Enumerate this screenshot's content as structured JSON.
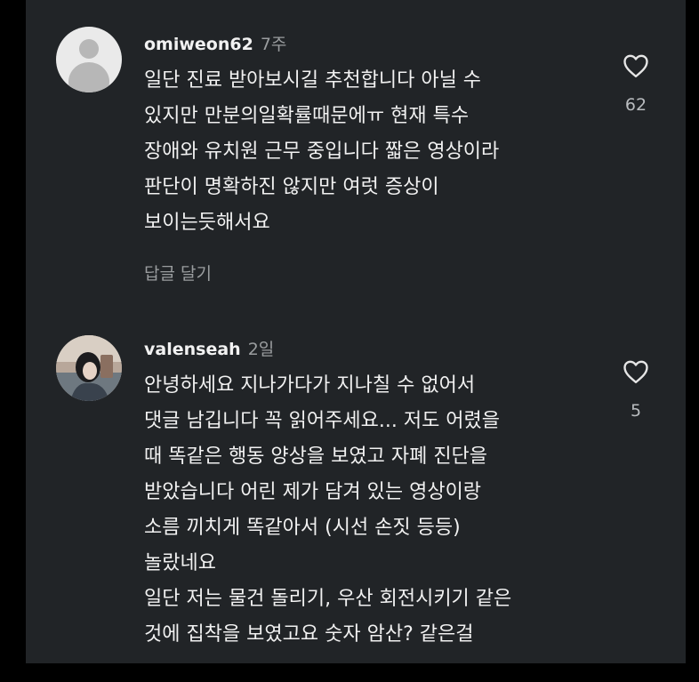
{
  "colors": {
    "panel_bg": "#212427",
    "outer_bg": "#000000",
    "text_primary": "#f1f1f1",
    "text_secondary": "#9a9d9f"
  },
  "comments": [
    {
      "username": "omiweon62",
      "time": "7주",
      "avatar": "default-avatar-icon",
      "lines": [
        "일단 진료 받아보시길 추천합니다 아닐 수",
        "있지만 만분의일확률때문에ㅠ 현재 특수",
        "장애와 유치원 근무 중입니다  짧은 영상이라",
        "판단이 명확하진 않지만 여럿 증상이",
        "보이는듯해서요"
      ],
      "reply_label": "답글 달기",
      "likes": "62",
      "like_icon": "heart-outline-icon"
    },
    {
      "username": "valenseah",
      "time": "2일",
      "avatar": "profile-photo",
      "lines": [
        "안녕하세요 지나가다가 지나칠 수 없어서",
        "댓글 남깁니다 꼭 읽어주세요... 저도 어렸을",
        "때 똑같은 행동 양상을 보였고 자폐 진단을",
        "받았습니다 어린 제가 담겨 있는 영상이랑",
        "소름 끼치게 똑같아서 (시선 손짓 등등)",
        "놀랐네요",
        "일단 저는 물건 돌리기, 우산 회전시키기 같은",
        "것에 집착을 보였고요 숫자 암산? 같은걸"
      ],
      "likes": "5",
      "like_icon": "heart-outline-icon"
    }
  ]
}
